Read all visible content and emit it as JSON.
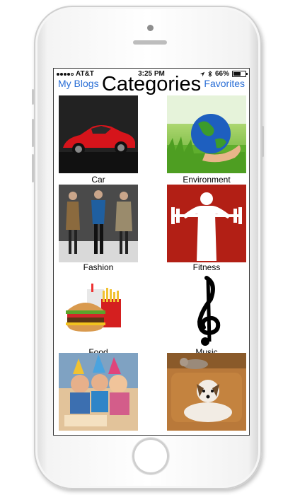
{
  "status_bar": {
    "carrier": "AT&T",
    "time": "3:25 PM",
    "battery": "66%",
    "battery_level": 0.66
  },
  "nav": {
    "left_button": "My Blogs",
    "title": "Categories",
    "right_button": "Favorites"
  },
  "categories": [
    {
      "label": "Car",
      "icon": "car-image"
    },
    {
      "label": "Environment",
      "icon": "earth-in-hand-image"
    },
    {
      "label": "Fashion",
      "icon": "fashion-runway-image"
    },
    {
      "label": "Fitness",
      "icon": "weightlifter-image"
    },
    {
      "label": "Food",
      "icon": "burger-fries-drink-image"
    },
    {
      "label": "Music",
      "icon": "treble-clef-image"
    },
    {
      "label": "",
      "icon": "birthday-party-image"
    },
    {
      "label": "",
      "icon": "dog-on-couch-image"
    }
  ],
  "colors": {
    "link_blue": "#2b6fd6",
    "fitness_red": "#b21f15"
  }
}
